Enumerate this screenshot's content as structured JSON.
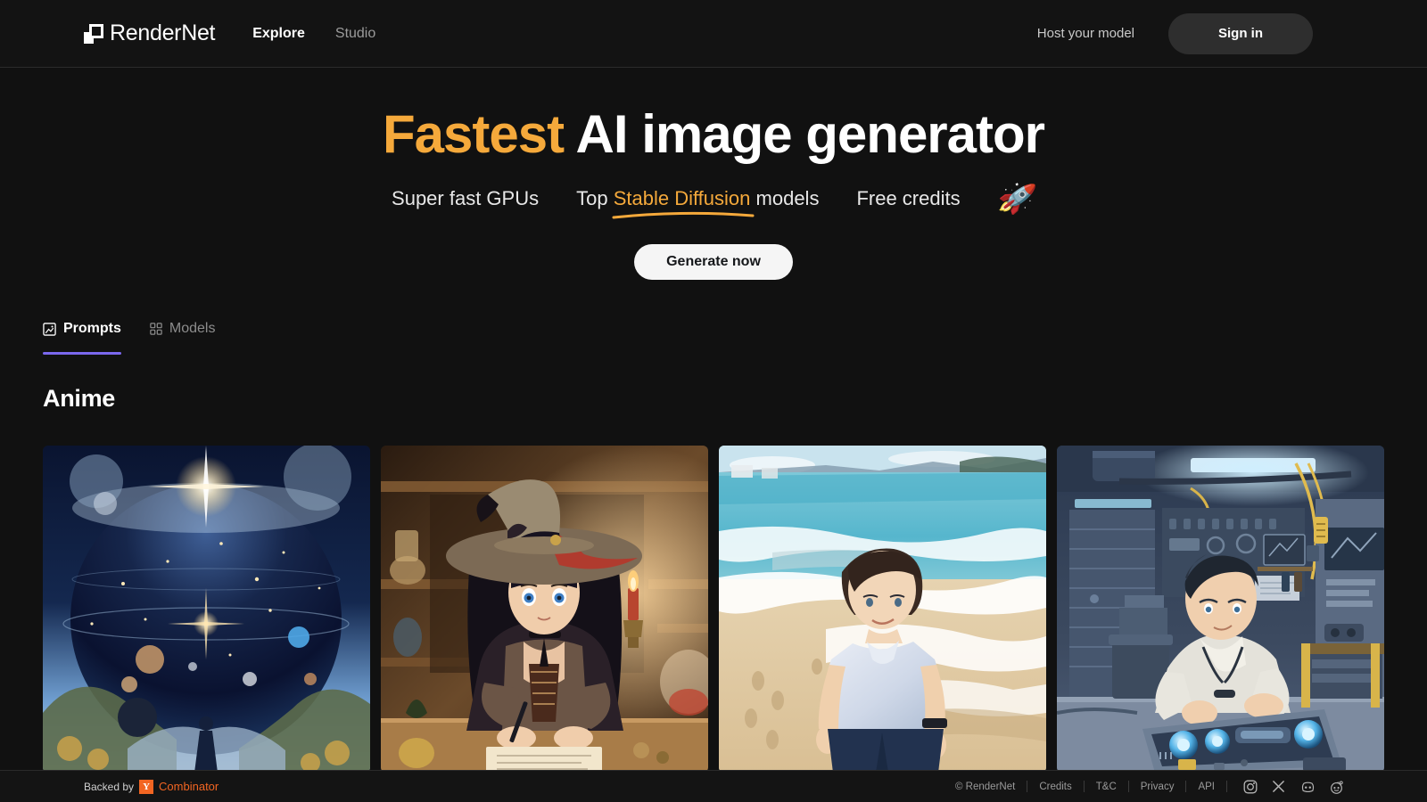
{
  "header": {
    "logo_text": "RenderNet",
    "logo_icon": "rendernet-logo-icon",
    "nav": [
      {
        "label": "Explore",
        "active": true
      },
      {
        "label": "Studio",
        "active": false
      }
    ],
    "host_link": "Host your model",
    "signin_label": "Sign in"
  },
  "hero": {
    "title_accent": "Fastest",
    "title_rest": " AI image generator",
    "sub_1": "Super fast GPUs",
    "sub_2_pre": "Top ",
    "sub_2_accent": "Stable Diffusion",
    "sub_2_post": " models",
    "sub_3": "Free credits",
    "rocket_icon": "🚀",
    "cta_label": "Generate now"
  },
  "tabs": [
    {
      "label": "Prompts",
      "icon": "image-icon",
      "active": true
    },
    {
      "label": "Models",
      "icon": "grid-icon",
      "active": false
    }
  ],
  "section": {
    "title": "Anime"
  },
  "gallery": {
    "cards": [
      {
        "name": "cosmic-planet-starlight",
        "alt": "Giant blue planet with starburst above a mountain landscape and lone figure"
      },
      {
        "name": "witch-girl-writing",
        "alt": "Anime witch with wide brimmed hat writing at a candlelit desk"
      },
      {
        "name": "boy-on-beach",
        "alt": "Anime boy in white t-shirt walking along a sunny shoreline"
      },
      {
        "name": "boy-in-workshop",
        "alt": "Anime boy repairing a glowing tech device in a cluttered garage workshop"
      }
    ]
  },
  "footer": {
    "backed_by": "Backed by",
    "yc_letter": "Y",
    "yc_text": "Combinator",
    "links": [
      "© RenderNet",
      "Credits",
      "T&C",
      "Privacy",
      "API"
    ],
    "socials": [
      {
        "name": "instagram-icon"
      },
      {
        "name": "x-twitter-icon"
      },
      {
        "name": "discord-icon"
      },
      {
        "name": "reddit-icon"
      }
    ]
  },
  "colors": {
    "background": "#111111",
    "accent_orange": "#F5A93B",
    "tab_underline": "#7B68EE",
    "yc_orange": "#F26522",
    "signin_bg": "#2E2E2E",
    "cta_bg": "#F5F5F5"
  }
}
